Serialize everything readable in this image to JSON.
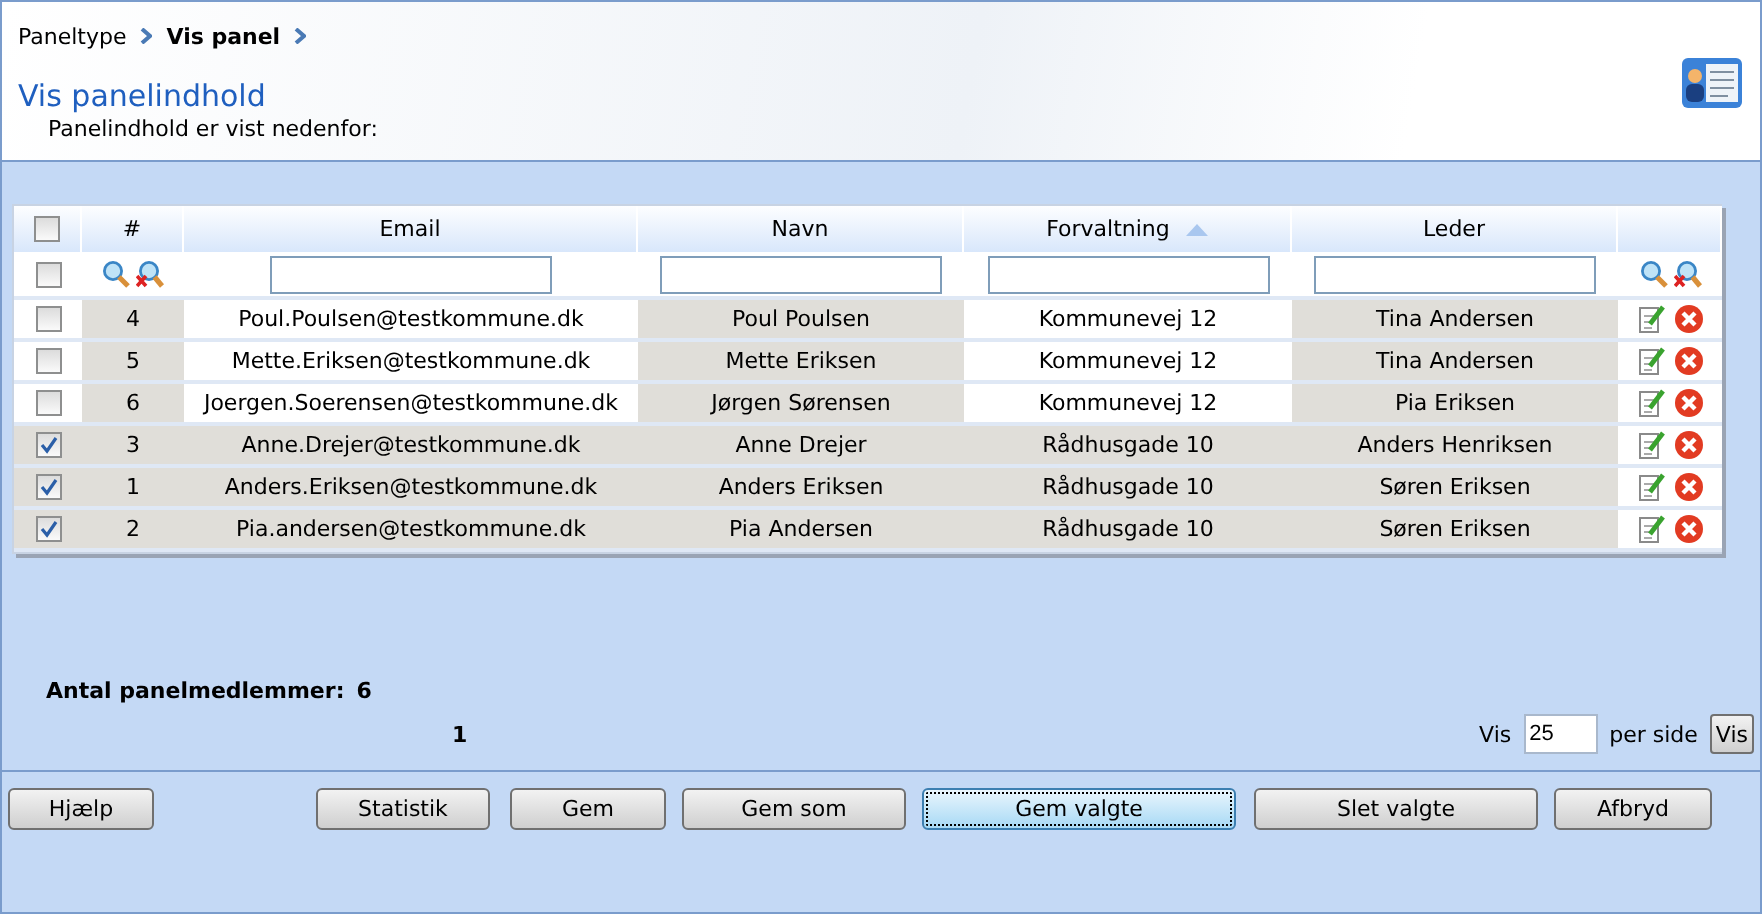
{
  "breadcrumb": [
    {
      "label": "Paneltype",
      "current": false
    },
    {
      "label": "Vis panel",
      "current": true
    }
  ],
  "header": {
    "title": "Vis panelindhold",
    "subtitle": "Panelindhold er vist nedenfor:"
  },
  "table": {
    "all_checked": false,
    "filter_checked": false,
    "columns": [
      {
        "label": "#",
        "sorted": false
      },
      {
        "label": "Email",
        "sorted": false
      },
      {
        "label": "Navn",
        "sorted": false
      },
      {
        "label": "Forvaltning",
        "sorted": true
      },
      {
        "label": "Leder",
        "sorted": false
      }
    ],
    "rows": [
      {
        "checked": false,
        "cells": [
          "4",
          "Poul.Poulsen@testkommune.dk",
          "Poul Poulsen",
          "Kommunevej 12",
          "Tina Andersen"
        ]
      },
      {
        "checked": false,
        "cells": [
          "5",
          "Mette.Eriksen@testkommune.dk",
          "Mette Eriksen",
          "Kommunevej 12",
          "Tina Andersen"
        ]
      },
      {
        "checked": false,
        "cells": [
          "6",
          "Joergen.Soerensen@testkommune.dk",
          "Jørgen Sørensen",
          "Kommunevej 12",
          "Pia Eriksen"
        ]
      },
      {
        "checked": true,
        "cells": [
          "3",
          "Anne.Drejer@testkommune.dk",
          "Anne Drejer",
          "Rådhusgade 10",
          "Anders Henriksen"
        ]
      },
      {
        "checked": true,
        "cells": [
          "1",
          "Anders.Eriksen@testkommune.dk",
          "Anders Eriksen",
          "Rådhusgade 10",
          "Søren Eriksen"
        ]
      },
      {
        "checked": true,
        "cells": [
          "2",
          "Pia.andersen@testkommune.dk",
          "Pia Andersen",
          "Rådhusgade 10",
          "Søren Eriksen"
        ]
      }
    ]
  },
  "count": {
    "label": "Antal panelmedlemmer:",
    "value": "6"
  },
  "pager": {
    "page": "1",
    "show_label": "Vis",
    "per_page": "25",
    "per_side_label": "per side",
    "button": "Vis"
  },
  "buttons": [
    {
      "label": "Hjælp",
      "focused": false
    },
    {
      "label": "Statistik",
      "focused": false
    },
    {
      "label": "Gem",
      "focused": false
    },
    {
      "label": "Gem som",
      "focused": false
    },
    {
      "label": "Gem valgte",
      "focused": true
    },
    {
      "label": "Slet valgte",
      "focused": false
    },
    {
      "label": "Afbryd",
      "focused": false
    }
  ]
}
